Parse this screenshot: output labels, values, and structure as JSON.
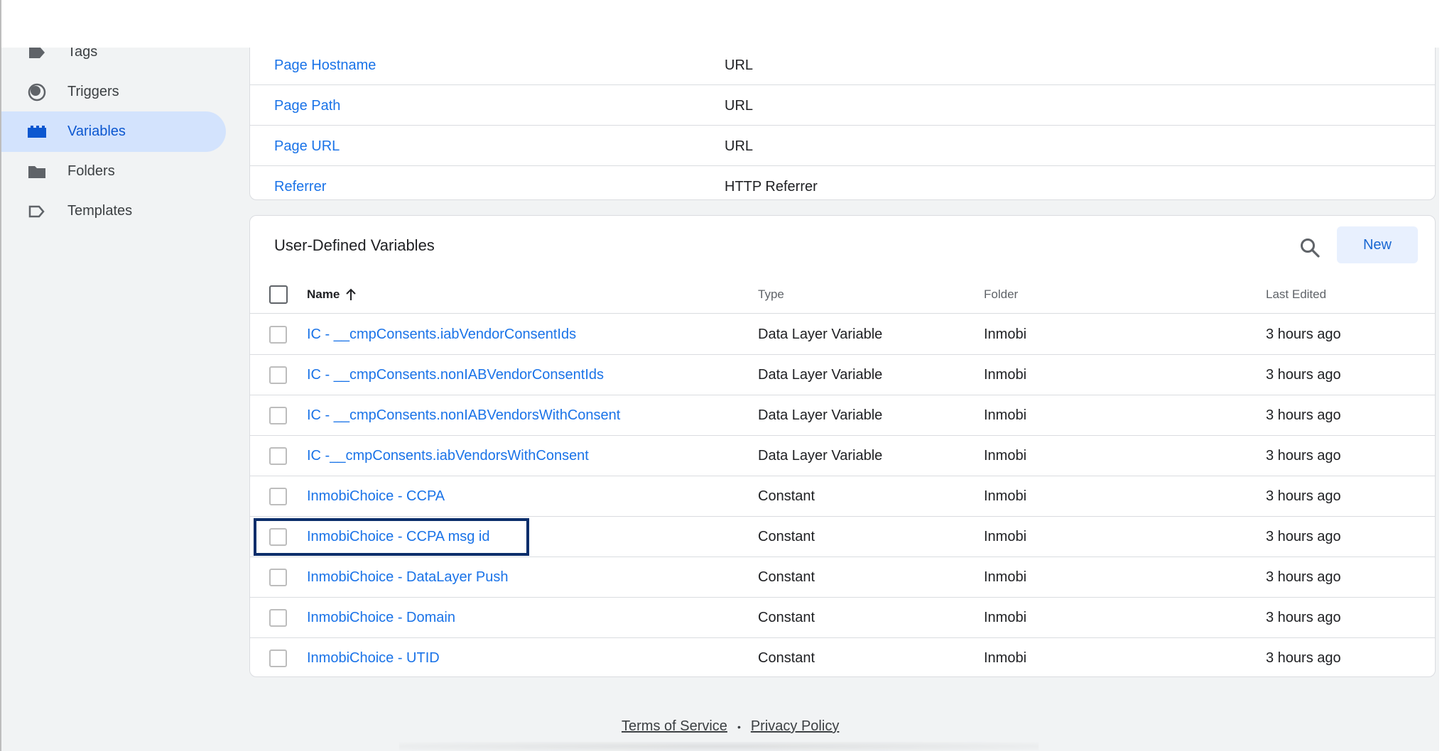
{
  "sidebar": {
    "items": [
      {
        "label": "Tags",
        "icon": "tag-icon"
      },
      {
        "label": "Triggers",
        "icon": "trigger-icon"
      },
      {
        "label": "Variables",
        "icon": "variables-icon",
        "active": true
      },
      {
        "label": "Folders",
        "icon": "folder-icon"
      },
      {
        "label": "Templates",
        "icon": "template-icon"
      }
    ]
  },
  "builtin": {
    "rows": [
      {
        "name": "Page Hostname",
        "type": "URL"
      },
      {
        "name": "Page Path",
        "type": "URL"
      },
      {
        "name": "Page URL",
        "type": "URL"
      },
      {
        "name": "Referrer",
        "type": "HTTP Referrer"
      }
    ]
  },
  "udv": {
    "title": "User-Defined Variables",
    "new_label": "New",
    "columns": {
      "name": "Name",
      "type": "Type",
      "folder": "Folder",
      "edited": "Last Edited"
    },
    "rows": [
      {
        "name": "IC - __cmpConsents.iabVendorConsentIds",
        "type": "Data Layer Variable",
        "folder": "Inmobi",
        "edited": "3 hours ago"
      },
      {
        "name": "IC - __cmpConsents.nonIABVendorConsentIds",
        "type": "Data Layer Variable",
        "folder": "Inmobi",
        "edited": "3 hours ago"
      },
      {
        "name": "IC - __cmpConsents.nonIABVendorsWithConsent",
        "type": "Data Layer Variable",
        "folder": "Inmobi",
        "edited": "3 hours ago"
      },
      {
        "name": "IC -__cmpConsents.iabVendorsWithConsent",
        "type": "Data Layer Variable",
        "folder": "Inmobi",
        "edited": "3 hours ago"
      },
      {
        "name": "InmobiChoice - CCPA",
        "type": "Constant",
        "folder": "Inmobi",
        "edited": "3 hours ago"
      },
      {
        "name": "InmobiChoice - CCPA msg id",
        "type": "Constant",
        "folder": "Inmobi",
        "edited": "3 hours ago"
      },
      {
        "name": "InmobiChoice - DataLayer Push",
        "type": "Constant",
        "folder": "Inmobi",
        "edited": "3 hours ago"
      },
      {
        "name": "InmobiChoice - Domain",
        "type": "Constant",
        "folder": "Inmobi",
        "edited": "3 hours ago"
      },
      {
        "name": "InmobiChoice - UTID",
        "type": "Constant",
        "folder": "Inmobi",
        "edited": "3 hours ago"
      }
    ]
  },
  "footer": {
    "terms": "Terms of Service",
    "separator": "•",
    "privacy": "Privacy Policy"
  },
  "colors": {
    "link": "#1a73e8",
    "active_bg": "#d3e3fd",
    "new_btn_bg": "#e8f0fe"
  }
}
